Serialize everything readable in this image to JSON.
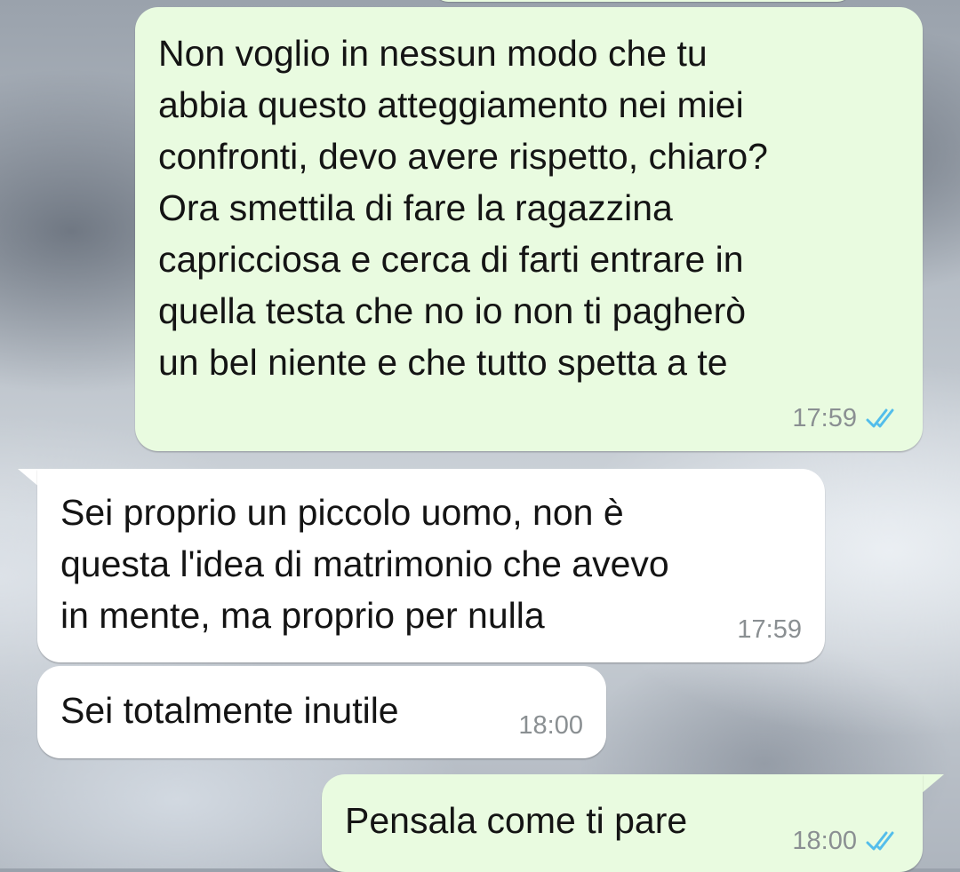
{
  "conversation": {
    "messages": [
      {
        "direction": "outgoing",
        "text": "Non voglio in nessun modo che tu\nabbia questo atteggiamento nei miei\nconfronti, devo avere rispetto, chiaro?\nOra smettila di fare la ragazzina\ncapricciosa e cerca di farti entrare in\nquella testa che no io non ti pagherò\nun bel niente e che tutto spetta a te",
        "time": "17:59",
        "status_icon": "double-check-read-icon"
      },
      {
        "direction": "incoming",
        "text": "Sei proprio un piccolo uomo, non è\nquesta l'idea di matrimonio che avevo\nin mente, ma proprio per nulla",
        "time": "17:59"
      },
      {
        "direction": "incoming",
        "text": "Sei totalmente inutile",
        "time": "18:00"
      },
      {
        "direction": "outgoing",
        "text": "Pensala come ti pare",
        "time": "18:00",
        "status_icon": "double-check-read-icon"
      }
    ]
  },
  "colors": {
    "outgoing_bubble": "#e9fbe0",
    "incoming_bubble": "#ffffff",
    "timestamp": "#8a8f92",
    "read_ticks": "#53bdeb"
  }
}
